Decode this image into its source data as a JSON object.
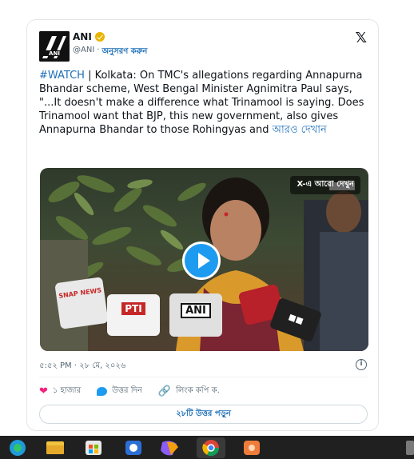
{
  "tweet": {
    "author_name": "ANI",
    "avatar_text": "ANI",
    "handle": "@ANI",
    "separator": "·",
    "follow_label": "অনুসরণ করুন",
    "x_logo": "𝕏",
    "hashtag": "#WATCH",
    "body": " | Kolkata: On TMC's allegations regarding Annapurna Bhandar scheme, West Bengal Minister Agnimitra Paul says, \"...It doesn't make a difference what Trinamool is saying. Does Trinamool want that BJP, this new government, also gives Annapurna Bhandar to those Rohingyas and ",
    "more_link": "আরও দেখান",
    "timestamp": "৫:৫২ PM · ২৮ মে, ২০২৬",
    "info_icon": "i"
  },
  "media": {
    "overlay_label": "X-এ আরো দেখুন",
    "play_icon": "play-icon",
    "mic_snap": "SNAP NEWS",
    "mic_pti": "PTI",
    "mic_ani": "ANI",
    "mic_black": "■■"
  },
  "actions": {
    "likes_label": "১ হাজার",
    "reply_label": "উত্তর দিন",
    "copy_link_label": "লিংক কপি ক."
  },
  "read_replies_label": "২৮টি উত্তর পড়ুন",
  "taskbar": {
    "icons": [
      "edge-icon",
      "file-explorer-icon",
      "store-icon",
      "app-icon",
      "copilot-icon",
      "chrome-icon",
      "photo-app-icon"
    ]
  },
  "colors": {
    "link_blue": "#1d6fb8",
    "heart_pink": "#f4217d",
    "verified_gold": "#e8b400",
    "play_blue": "#1d9bf0"
  }
}
